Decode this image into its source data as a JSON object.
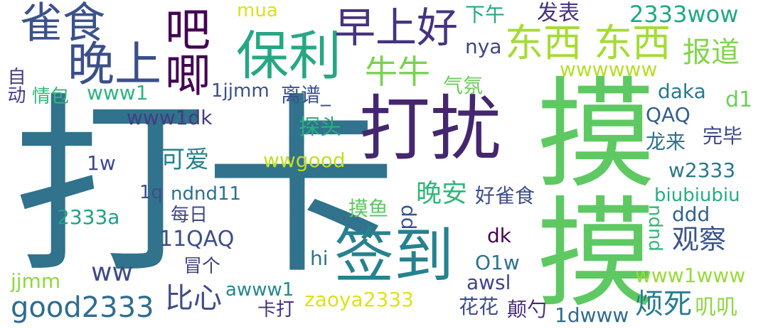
{
  "words": [
    {
      "text": "打卡",
      "color": "#31728c"
    },
    {
      "text": "摸摸",
      "color": "#5ec962"
    },
    {
      "text": "打扰",
      "color": "#45276f"
    },
    {
      "text": "签到",
      "color": "#26828e"
    },
    {
      "text": "保利",
      "color": "#26a784"
    },
    {
      "text": "晚上",
      "color": "#3b4f8a"
    },
    {
      "text": "早上好",
      "color": "#46337f"
    },
    {
      "text": "雀食",
      "color": "#3b528b"
    },
    {
      "text": "东西 东西",
      "color": "#a5db36"
    },
    {
      "text": "吧唧",
      "color": "#440154"
    },
    {
      "text": "牛牛",
      "color": "#7ad151"
    },
    {
      "text": "报道",
      "color": "#84d44b"
    },
    {
      "text": "下午",
      "color": "#22a884"
    },
    {
      "text": "发表",
      "color": "#46327e"
    },
    {
      "text": "2333wow",
      "color": "#22a784"
    },
    {
      "text": "mua",
      "color": "#d8e219"
    },
    {
      "text": "nya",
      "color": "#414487"
    },
    {
      "text": "wwwwww",
      "color": "#b5de2b"
    },
    {
      "text": "自动",
      "color": "#433e85"
    },
    {
      "text": "情包",
      "color": "#35b779"
    },
    {
      "text": "www1",
      "color": "#2fb47c"
    },
    {
      "text": "1jjmm",
      "color": "#3b518b"
    },
    {
      "text": "离谱_",
      "color": "#3b528b"
    },
    {
      "text": "气氛",
      "color": "#6ccd5a"
    },
    {
      "text": "daka",
      "color": "#2a788e"
    },
    {
      "text": "d1",
      "color": "#6ece58"
    },
    {
      "text": "www1dk",
      "color": "#433d84"
    },
    {
      "text": "QAQ",
      "color": "#355f8d"
    },
    {
      "text": "探头",
      "color": "#29af7f"
    },
    {
      "text": "完毕",
      "color": "#3f4788"
    },
    {
      "text": "龙来",
      "color": "#2c728e"
    },
    {
      "text": "可爱",
      "color": "#26818e"
    },
    {
      "text": "wwgood",
      "color": "#c2df23"
    },
    {
      "text": "1w",
      "color": "#3e4989"
    },
    {
      "text": "w2333",
      "color": "#2a778e"
    },
    {
      "text": "晚安",
      "color": "#32b67a"
    },
    {
      "text": "好雀食",
      "color": "#3d4e8a"
    },
    {
      "text": "1q",
      "color": "#3c508b"
    },
    {
      "text": "ndnd11",
      "color": "#2d708e"
    },
    {
      "text": "biubiubiu",
      "color": "#26ad81"
    },
    {
      "text": "2333a",
      "color": "#1fa187"
    },
    {
      "text": "每日",
      "color": "#3f4889"
    },
    {
      "text": "摸鱼",
      "color": "#5dc863"
    },
    {
      "text": "dd",
      "color": "#3a548c"
    },
    {
      "text": "ndnd",
      "color": "#35b779"
    },
    {
      "text": "ddd",
      "color": "#33638d"
    },
    {
      "text": "11QAQ",
      "color": "#3d4d8a"
    },
    {
      "text": "dk",
      "color": "#440256"
    },
    {
      "text": "观察",
      "color": "#3a548c"
    },
    {
      "text": "ww",
      "color": "#3e4a89"
    },
    {
      "text": "冒个",
      "color": "#424186"
    },
    {
      "text": "hi",
      "color": "#2a768e"
    },
    {
      "text": "O1w",
      "color": "#2c738e"
    },
    {
      "text": "jjmm",
      "color": "#90d743"
    },
    {
      "text": "www1www",
      "color": "#9bd93c"
    },
    {
      "text": "awsl",
      "color": "#414487"
    },
    {
      "text": "awww1",
      "color": "#24878e"
    },
    {
      "text": "good2333",
      "color": "#2e6d8e"
    },
    {
      "text": "比心",
      "color": "#3e4c8a"
    },
    {
      "text": "烦死",
      "color": "#2a7b8e"
    },
    {
      "text": "卡打",
      "color": "#46307e"
    },
    {
      "text": "zaoya2333",
      "color": "#dde318"
    },
    {
      "text": "花花",
      "color": "#3e4a89"
    },
    {
      "text": "颠勺",
      "color": "#472c7a"
    },
    {
      "text": "1dwww",
      "color": "#2f6c8e"
    },
    {
      "text": "叽叽",
      "color": "#8fd744"
    }
  ]
}
